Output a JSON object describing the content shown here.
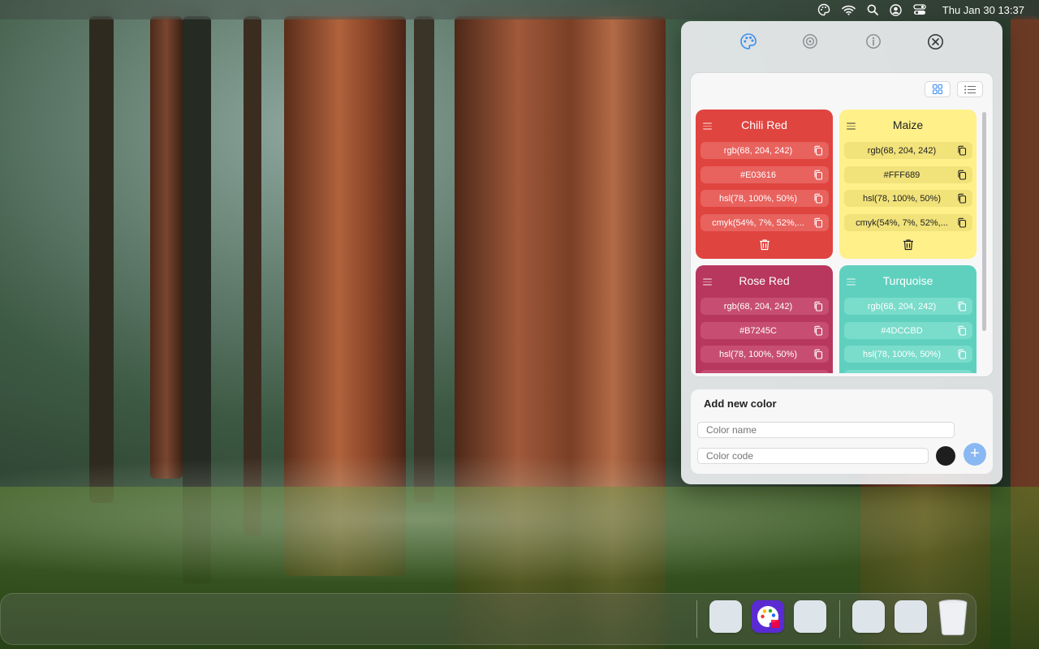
{
  "menubar": {
    "icons": [
      "palette-icon",
      "wifi-icon",
      "search-icon",
      "user-icon",
      "control-center-icon"
    ],
    "clock": "Thu Jan 30  13:37"
  },
  "popover": {
    "toolbar": [
      "palette-icon",
      "settings-icon",
      "info-icon",
      "close-icon"
    ],
    "view_modes": [
      "grid-view-icon",
      "list-view-icon"
    ],
    "colors": [
      {
        "name": "Chili Red",
        "bg": "#E0443F",
        "chip_bg": "#E8625E",
        "text_color": "#ffffff",
        "rgb": "rgb(68, 204, 242)",
        "hex": "#E03616",
        "hsl": "hsl(78, 100%, 50%)",
        "cmyk": "cmyk(54%, 7%, 52%,..."
      },
      {
        "name": "Maize",
        "bg": "#FFF08A",
        "chip_bg": "#F1E27A",
        "text_color": "#222222",
        "rgb": "rgb(68, 204, 242)",
        "hex": "#FFF689",
        "hsl": "hsl(78, 100%, 50%)",
        "cmyk": "cmyk(54%, 7%, 52%,..."
      },
      {
        "name": "Rose Red",
        "bg": "#B7375F",
        "chip_bg": "#C74E72",
        "text_color": "#ffffff",
        "rgb": "rgb(68, 204, 242)",
        "hex": "#B7245C",
        "hsl": "hsl(78, 100%, 50%)"
      },
      {
        "name": "Turquoise",
        "bg": "#5FD0BE",
        "chip_bg": "#7ADCCB",
        "text_color": "#ffffff",
        "rgb": "rgb(68, 204, 242)",
        "hex": "#4DCCBD",
        "hsl": "hsl(78, 100%, 50%)"
      }
    ],
    "add_form": {
      "title": "Add new color",
      "name_placeholder": "Color name",
      "code_placeholder": "Color code",
      "add_label": "+"
    }
  },
  "dock": {
    "apps": [
      "app-placeholder",
      "color-palette-app",
      "app-placeholder",
      "app-placeholder",
      "app-placeholder",
      "trash"
    ]
  }
}
